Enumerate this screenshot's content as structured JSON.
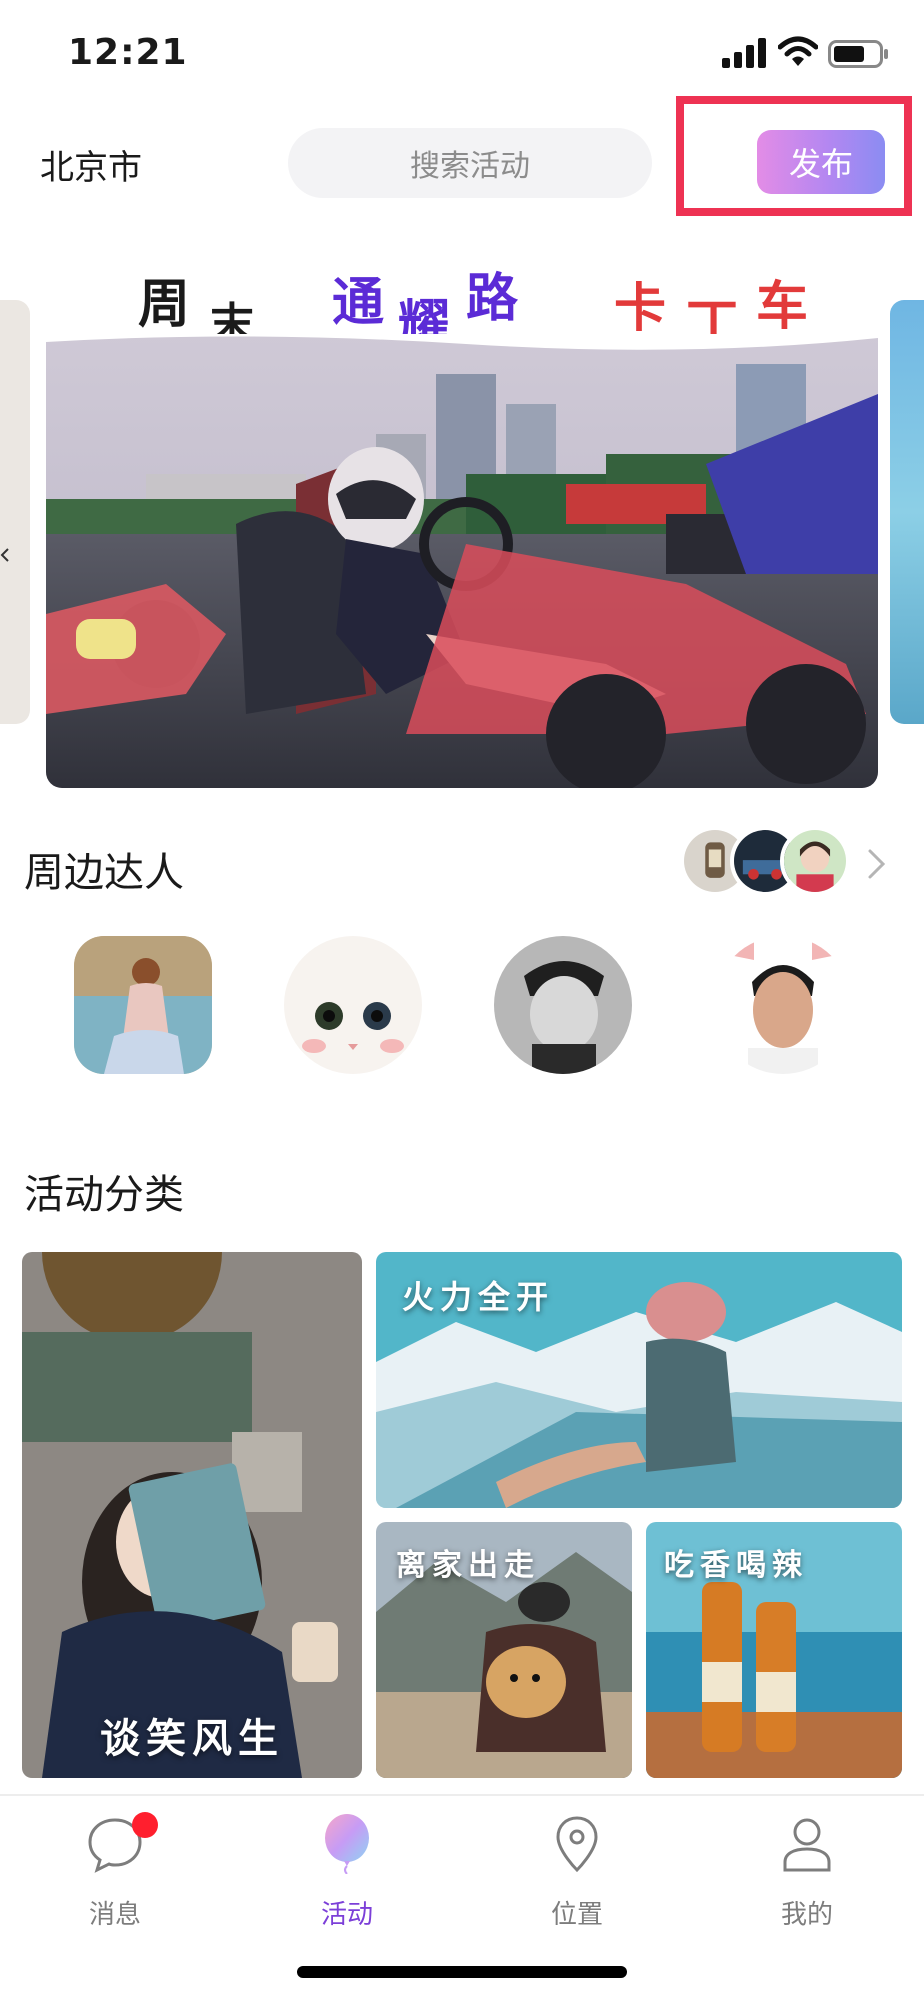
{
  "status_bar": {
    "time": "12:21"
  },
  "header": {
    "city": "北京市",
    "search_placeholder": "搜索活动",
    "publish_label": "发布"
  },
  "banner": {
    "title_chars": [
      {
        "text": "周",
        "color": "#1a1a1a"
      },
      {
        "text": "末",
        "color": "#1a1a1a"
      },
      {
        "text": "通",
        "color": "#5b2bd6"
      },
      {
        "text": "耀",
        "color": "#5b2bd6"
      },
      {
        "text": "路",
        "color": "#5b2bd6"
      },
      {
        "text": "卡",
        "color": "#e23a3a"
      },
      {
        "text": "丁",
        "color": "#e23a3a"
      },
      {
        "text": "车",
        "color": "#e23a3a"
      }
    ],
    "page_count": 3,
    "active_page": 1
  },
  "nearby": {
    "title": "周边达人"
  },
  "categories": {
    "title": "活动分类",
    "items": [
      {
        "label": "谈笑风生"
      },
      {
        "label": "火力全开"
      },
      {
        "label": "离家出走"
      },
      {
        "label": "吃香喝辣"
      }
    ]
  },
  "tabbar": {
    "items": [
      {
        "label": "消息",
        "icon": "chat-bubble-icon",
        "active": false,
        "badge": true
      },
      {
        "label": "活动",
        "icon": "balloon-icon",
        "active": true
      },
      {
        "label": "位置",
        "icon": "location-pin-icon",
        "active": false
      },
      {
        "label": "我的",
        "icon": "person-icon",
        "active": false
      }
    ]
  },
  "colors": {
    "accent": "#7c3fd8",
    "publish_gradient_start": "#e38ce6",
    "publish_gradient_end": "#8b8cf2",
    "highlight_outline": "#ee3253",
    "badge": "#ff1f2e"
  }
}
